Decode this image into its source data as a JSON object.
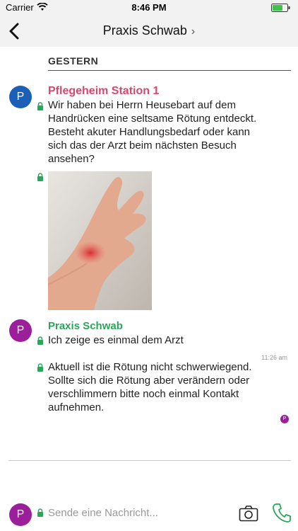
{
  "status_bar": {
    "carrier": "Carrier",
    "time": "8:46 PM"
  },
  "nav": {
    "title": "Praxis Schwab",
    "chevron": "›"
  },
  "day_header": "GESTERN",
  "messages": [
    {
      "avatar": "P",
      "sender": "Pflegeheim Station 1",
      "lines": [
        "Wir haben bei Herrn Heusebart auf dem",
        "Handrücken eine seltsame Rötung entdeckt.",
        "Besteht akuter Handlungsbedarf oder kann",
        "sich das der Arzt beim nächsten Besuch",
        "ansehen?"
      ]
    },
    {
      "avatar": "P",
      "sender": "Praxis Schwab",
      "text1": "Ich zeige es einmal dem Arzt",
      "time": "11:26 am",
      "lines2": [
        "Aktuell ist die Rötung nicht schwerwiegend.",
        "Sollte sich die Rötung aber verändern oder",
        "verschlimmern bitte noch einmal Kontakt",
        "aufnehmen."
      ],
      "read_avatar": "P"
    }
  ],
  "composer": {
    "avatar": "P",
    "placeholder": "Sende eine Nachricht..."
  },
  "colors": {
    "accent_green": "#2aa65a",
    "pink": "#d8476e",
    "blue_avatar": "#1c5fb8",
    "purple_avatar": "#9b1f9b"
  },
  "icons": [
    "wifi-icon",
    "battery-icon",
    "back-chevron-icon",
    "lock-icon",
    "camera-icon",
    "phone-icon"
  ]
}
